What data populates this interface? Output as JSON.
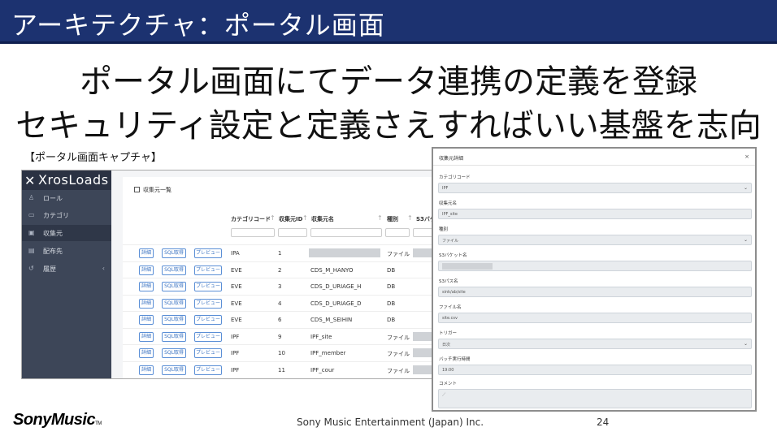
{
  "slide": {
    "title": "アーキテクチャ：ポータル画面",
    "headline1": "ポータル画面にてデータ連携の定義を登録",
    "headline2": "セキュリティ設定と定義さえすればいい基盤を志向",
    "caption": "【ポータル画面キャプチャ】",
    "footer_brand": "SonyMusic",
    "footer_brand_tm": "TM",
    "footer_copyright": "Sony Music Entertainment (Japan) Inc.",
    "page_number": "24"
  },
  "portal": {
    "logo_text": "XrosLoads",
    "nav": [
      {
        "label": "ロール",
        "icon": "person-icon"
      },
      {
        "label": "カテゴリ",
        "icon": "folder-icon"
      },
      {
        "label": "収集元",
        "icon": "inbox-icon"
      },
      {
        "label": "配布先",
        "icon": "send-icon"
      },
      {
        "label": "履歴",
        "icon": "history-icon"
      }
    ],
    "panel_title": "収集元一覧",
    "columns": [
      "カテゴリコード",
      "収集元ID",
      "収集元名",
      "種別",
      "S3バケ"
    ],
    "buttons": {
      "detail": "詳細",
      "sql": "SQL取得",
      "preview": "プレビュー"
    },
    "rows": [
      {
        "category": "IPA",
        "id": "1",
        "name": "",
        "type": "ファイル"
      },
      {
        "category": "EVE",
        "id": "2",
        "name": "CDS_M_HANYO",
        "type": "DB"
      },
      {
        "category": "EVE",
        "id": "3",
        "name": "CDS_D_URIAGE_H",
        "type": "DB"
      },
      {
        "category": "EVE",
        "id": "4",
        "name": "CDS_D_URIAGE_D",
        "type": "DB"
      },
      {
        "category": "EVE",
        "id": "6",
        "name": "CDS_M_SEIHIN",
        "type": "DB"
      },
      {
        "category": "IPF",
        "id": "9",
        "name": "IPF_site",
        "type": "ファイル"
      },
      {
        "category": "IPF",
        "id": "10",
        "name": "IPF_member",
        "type": "ファイル"
      },
      {
        "category": "IPF",
        "id": "11",
        "name": "IPF_cour",
        "type": "ファイル"
      }
    ]
  },
  "dialog": {
    "title": "収集元詳細",
    "close": "×",
    "fields": [
      {
        "label": "カテゴリコード",
        "value": "IPF",
        "select": true
      },
      {
        "label": "収集元名",
        "value": "IPF_site",
        "select": false
      },
      {
        "label": "種別",
        "value": "ファイル",
        "select": true
      },
      {
        "label": "S3バケット名",
        "value": "",
        "select": false
      },
      {
        "label": "S3パス名",
        "value": "sink/ab/site",
        "select": false
      },
      {
        "label": "ファイル名",
        "value": "site.csv",
        "select": false
      },
      {
        "label": "トリガー",
        "value": "日次",
        "select": true
      },
      {
        "label": "バッチ実行時間",
        "value": "19:00",
        "select": false
      }
    ],
    "comment_label": "コメント"
  }
}
